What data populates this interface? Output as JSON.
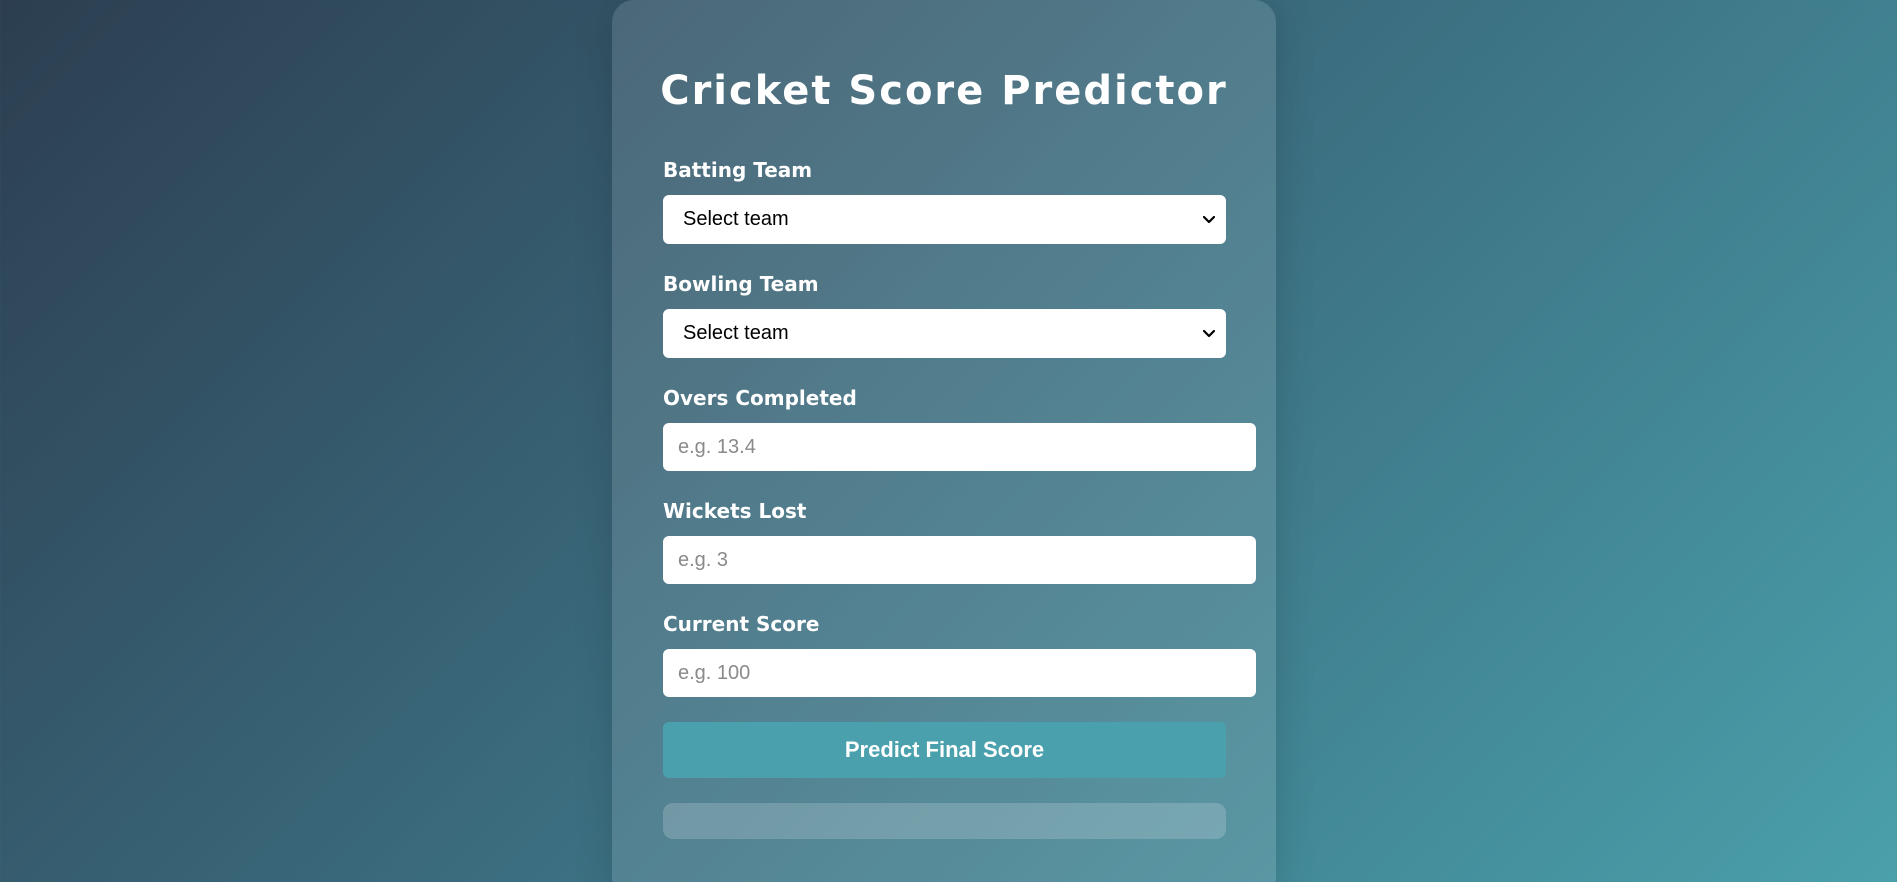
{
  "page": {
    "title": "Cricket Score Predictor"
  },
  "form": {
    "batting_team": {
      "label": "Batting Team",
      "selected": "Select team"
    },
    "bowling_team": {
      "label": "Bowling Team",
      "selected": "Select team"
    },
    "overs": {
      "label": "Overs Completed",
      "value": "",
      "placeholder": "e.g. 13.4"
    },
    "wickets": {
      "label": "Wickets Lost",
      "value": "",
      "placeholder": "e.g. 3"
    },
    "score": {
      "label": "Current Score",
      "value": "",
      "placeholder": "e.g. 100"
    },
    "submit_label": "Predict Final Score",
    "result": ""
  },
  "colors": {
    "button": "#4aa1ad",
    "background_start": "#2c3e50",
    "background_end": "#4aa0ab"
  }
}
